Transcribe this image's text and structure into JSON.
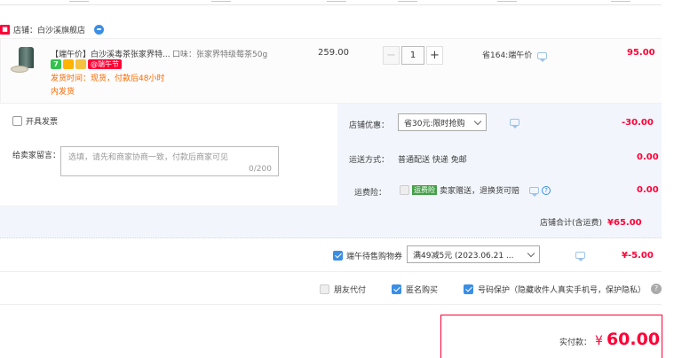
{
  "shop": {
    "label": "店铺：",
    "name": "白沙溪旗舰店",
    "icon_text": "■"
  },
  "item": {
    "title": "【端午价】白沙溪毒茶张家界特...",
    "variant": "口味：张家界特级莓茶50g",
    "badge_seven": "7",
    "promo_tag": "@端午节",
    "ship_line1": "发货时间：现货，付款后48小时",
    "ship_line2": "内发货",
    "price": "259.00",
    "quantity": "1",
    "minus": "−",
    "plus": "+",
    "saving": "省164:端午价",
    "subtotal": "95.00"
  },
  "invoice": {
    "label": "开具发票"
  },
  "message": {
    "label": "给卖家留言：",
    "placeholder": "选填，请先和商家协商一致，付款后商家可见",
    "counter": "0/200"
  },
  "shop_discount": {
    "label": "店铺优惠：",
    "option": "省30元:限时抢购",
    "amount": "-30.00"
  },
  "shipping": {
    "label": "运送方式：",
    "method": "普通配送 快递 免邮",
    "amount": "0.00"
  },
  "insurance": {
    "label": "运费险：",
    "tag": "运费险",
    "text": "卖家赠送，退换货可赔",
    "amount": "0.00"
  },
  "shop_total": {
    "label": "店铺合计(含运费)",
    "amount": "¥65.00"
  },
  "coupon": {
    "label": "端午待售购物券",
    "option": "满49减5元 (2023.06.21 ...",
    "amount": "¥-5.00"
  },
  "extras": {
    "friend_pay": "朋友代付",
    "anonymous": "匿名购买",
    "privacy": "号码保护（隐藏收件人真实手机号，保护隐私）",
    "help": "?"
  },
  "payment": {
    "label": "实付款：",
    "currency": "¥",
    "amount": "60.00"
  },
  "colors": {
    "accent_red": "#ff0036",
    "link_blue": "#3a8ee6",
    "orange": "#ff6a00",
    "band_bg": "#f2f6fc"
  }
}
